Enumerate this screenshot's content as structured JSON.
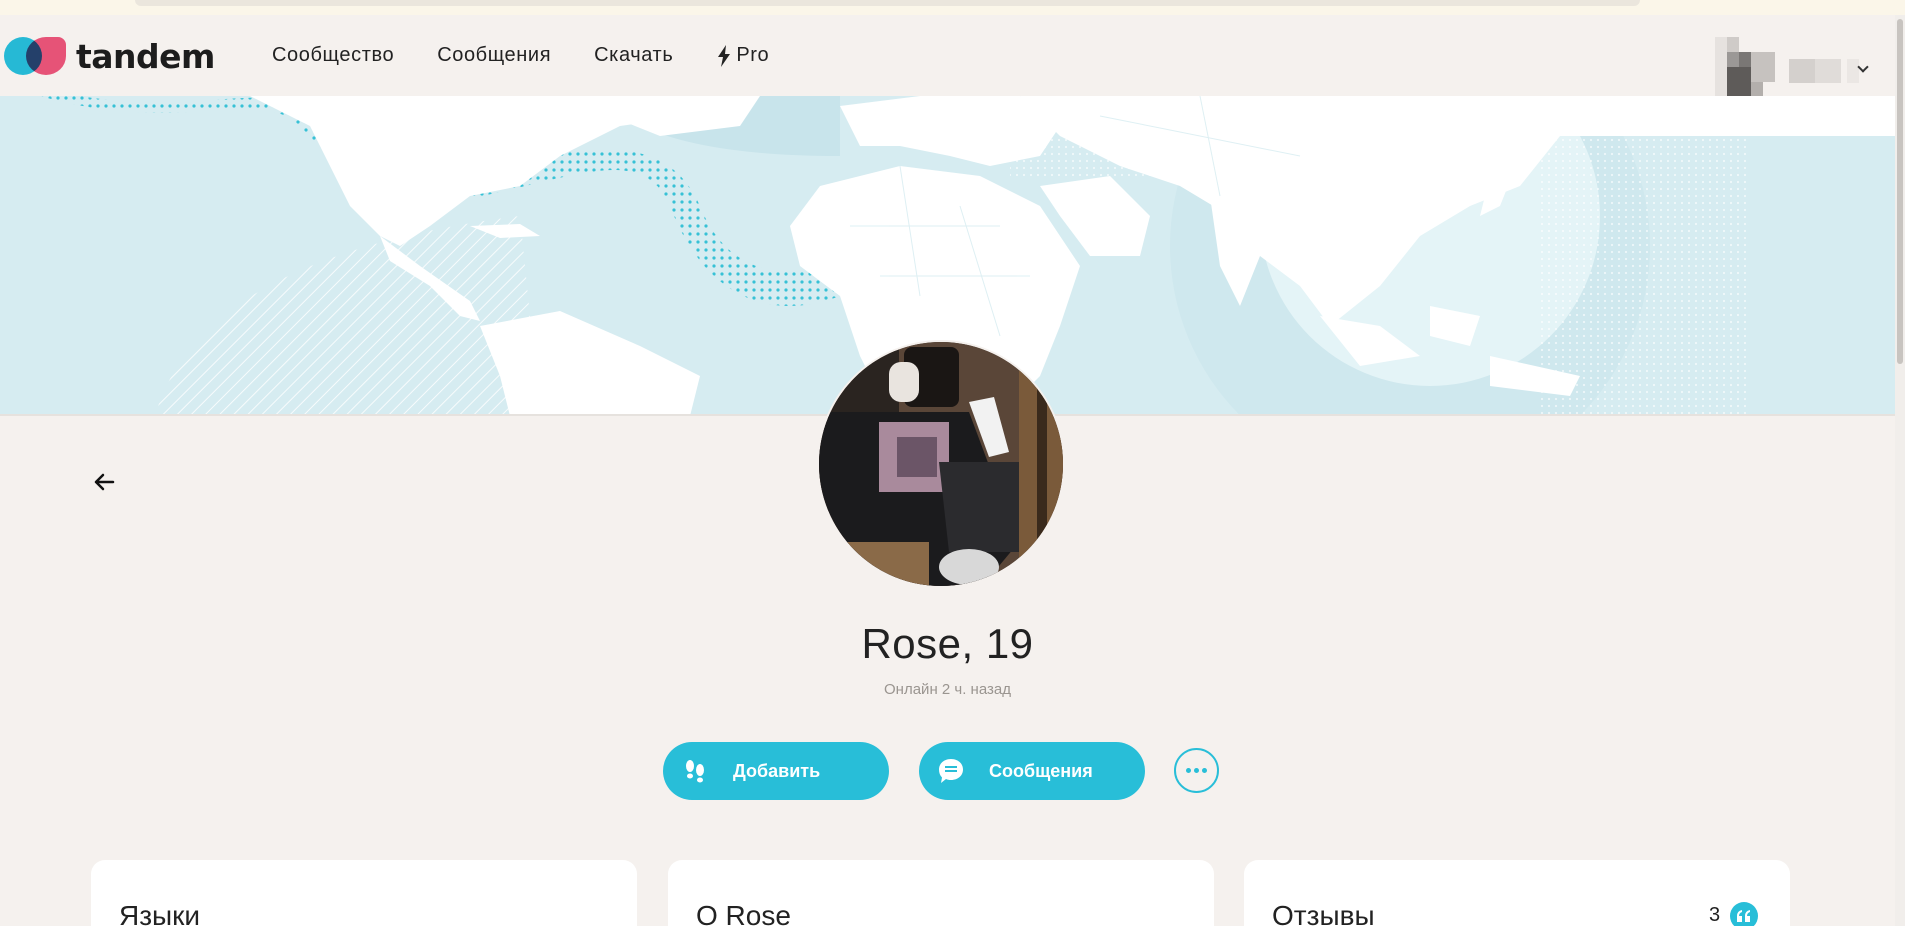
{
  "brand": {
    "name": "tandem"
  },
  "nav": {
    "items": [
      {
        "label": "Сообщество"
      },
      {
        "label": "Сообщения"
      },
      {
        "label": "Скачать"
      },
      {
        "label": "Pro",
        "icon": "bolt-icon"
      }
    ]
  },
  "profile": {
    "name_age": "Rose, 19",
    "status": "Онлайн 2 ч. назад",
    "actions": {
      "add_label": "Добавить",
      "message_label": "Сообщения"
    }
  },
  "cards": {
    "languages_title": "Языки",
    "about_title": "О Rose",
    "reviews_title": "Отзывы",
    "reviews_count": "3"
  },
  "colors": {
    "accent": "#28bed8",
    "background": "#f5f1ee",
    "map_sea": "#d6ecf1",
    "logo_blue": "#26b9d5",
    "logo_pink": "#f0587f"
  }
}
